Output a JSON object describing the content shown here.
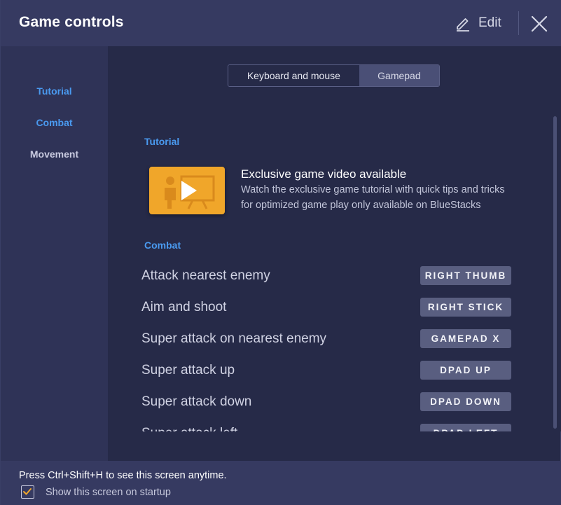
{
  "header": {
    "title": "Game controls",
    "edit_label": "Edit"
  },
  "sidebar": {
    "items": [
      {
        "label": "Tutorial",
        "active": true
      },
      {
        "label": "Combat",
        "active": true
      },
      {
        "label": "Movement",
        "active": false
      }
    ]
  },
  "mode_tabs": {
    "keyboard_label": "Keyboard and mouse",
    "gamepad_label": "Gamepad",
    "selected": "Gamepad"
  },
  "tutorial": {
    "heading": "Tutorial",
    "video_title": "Exclusive game video available",
    "video_description": "Watch the exclusive game tutorial with quick tips and tricks for optimized game play only available on BlueStacks"
  },
  "combat": {
    "heading": "Combat",
    "rows": [
      {
        "action": "Attack nearest enemy",
        "key": "RIGHT THUMB"
      },
      {
        "action": "Aim and shoot",
        "key": "RIGHT STICK"
      },
      {
        "action": "Super attack on nearest enemy",
        "key": "GAMEPAD X"
      },
      {
        "action": "Super attack up",
        "key": "DPAD UP"
      },
      {
        "action": "Super attack down",
        "key": "DPAD DOWN"
      },
      {
        "action": "Super attack left",
        "key": "DPAD LEFT"
      }
    ]
  },
  "footer": {
    "shortcut_note": "Press Ctrl+Shift+H to see this screen anytime.",
    "startup_label": "Show this screen on startup",
    "startup_checked": true
  },
  "colors": {
    "accent": "#4a9af0",
    "header_bg": "#363a61",
    "content_bg": "#262a48",
    "sidebar_bg": "#2f3357",
    "badge_bg": "#595e80",
    "video_orange": "#f0a62a",
    "check_orange": "#f0a62a"
  }
}
